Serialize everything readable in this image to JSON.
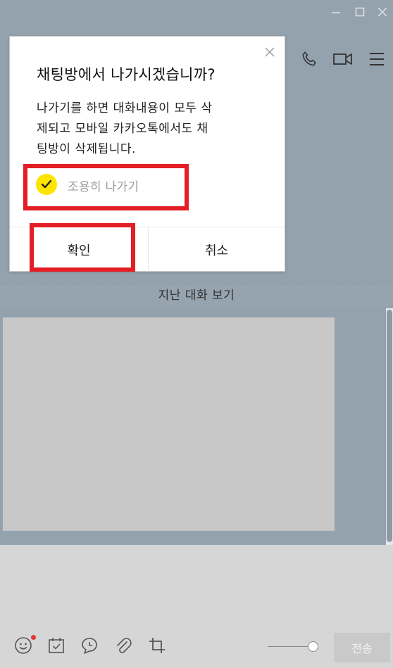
{
  "window": {
    "controls": [
      {
        "name": "minimize-icon"
      },
      {
        "name": "maximize-icon"
      },
      {
        "name": "close-window-icon"
      }
    ]
  },
  "header": {
    "icons": [
      "phone-icon",
      "video-call-icon",
      "menu-icon"
    ]
  },
  "dialog": {
    "title": "채팅방에서 나가시겠습니까?",
    "message": "나가기를 하면 대화내용이 모두 삭\n제되고 모바일 카카오톡에서도 채\n팅방이 삭제됩니다.",
    "quiet_leave_label": "조용히 나가기",
    "quiet_leave_checked": true,
    "confirm_label": "확인",
    "cancel_label": "취소"
  },
  "chat": {
    "history_label": "지난 대화 보기"
  },
  "composer": {
    "tool_icons": [
      "emoji-icon",
      "calendar-icon",
      "chat-bubble-icon",
      "attachment-icon",
      "crop-icon"
    ],
    "send_label": "전송"
  },
  "colors": {
    "chat_bg": "#94a2ae",
    "check_yellow": "#fee500",
    "annotation_red": "#e31e24",
    "badge_red": "#e03a3a"
  }
}
